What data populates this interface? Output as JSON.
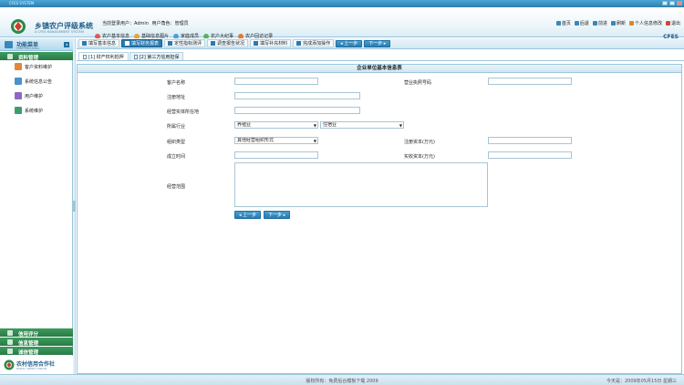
{
  "window": {
    "title": "CFES SYSTEM"
  },
  "header": {
    "app_title": "乡镇农户评级系统",
    "app_subtitle": "A CFES MANAGEMENT SYSTEM",
    "user_prefix": "当前登录用户：",
    "user_name": "Admin",
    "role_prefix": "用户角色：",
    "role_name": "管理员",
    "top_nav": [
      {
        "label": "农户基本信息",
        "color": "#e05a4b"
      },
      {
        "label": "基础信息图片",
        "color": "#e8a23a"
      },
      {
        "label": "家庭成员",
        "color": "#4aa0d8"
      },
      {
        "label": "农户大纪事",
        "color": "#58b15a"
      },
      {
        "label": "农户回访记录",
        "color": "#e07d2b"
      }
    ],
    "right_nav": [
      {
        "label": "首页",
        "color": "#3a87b9"
      },
      {
        "label": "后退",
        "color": "#3a87b9"
      },
      {
        "label": "前进",
        "color": "#3a87b9"
      },
      {
        "label": "刷新",
        "color": "#3a87b9"
      },
      {
        "label": "个人信息修改",
        "color": "#d28a2a"
      },
      {
        "label": "退出",
        "color": "#d04a3a"
      }
    ],
    "brand": "CFES"
  },
  "sidebar": {
    "title": "功能菜单",
    "subtitle": "FUNCTION MENU",
    "section_main": "资料管理",
    "items": [
      {
        "label": "客户资料维护",
        "color": "#e0873a"
      },
      {
        "label": "系统信息公告",
        "color": "#4a93c9"
      },
      {
        "label": "用户维护",
        "color": "#8b6bc1"
      },
      {
        "label": "系统维护",
        "color": "#3a9f6f"
      }
    ],
    "bottom_sections": [
      "信用评分",
      "信息管理",
      "诚信管理"
    ],
    "footer_title": "农村信用合作社",
    "footer_sub": "RURAL CREDIT UNION"
  },
  "steps": {
    "items": [
      {
        "label": "填写基本信息",
        "active": false
      },
      {
        "label": "填写财务报表",
        "active": true
      },
      {
        "label": "定性指标测评",
        "active": false
      },
      {
        "label": "调查报告状况",
        "active": false
      },
      {
        "label": "填写补充材料",
        "active": false
      },
      {
        "label": "完成添加操作",
        "active": false
      }
    ],
    "prev": "◂ 上一步",
    "next": "下一步 ▸"
  },
  "subtabs": [
    {
      "label": "[1] 财产权利抵押",
      "active": true
    },
    {
      "label": "[2] 第三方信用担保",
      "active": false
    }
  ],
  "form": {
    "heading": "企业单位基本信息表",
    "customer_name_label": "客户名称",
    "license_label": "营业执照号码",
    "reg_address_label": "注册地址",
    "biz_address_label": "经营实体所在地",
    "industry_label": "所属行业",
    "industry_value_1": "养殖业",
    "industry_value_2": "住宿业",
    "org_type_label": "组织类型",
    "org_type_value": "其他经营组织形式",
    "reg_capital_label": "注册资本(万元)",
    "found_time_label": "成立时间",
    "paid_capital_label": "实收资本(万元)",
    "scope_label": "经营范围",
    "prev_button": "◂ 上一步",
    "next_button": "下一步 ▸"
  },
  "status": {
    "copyright": "版权所有：免费后台模板下载 2009",
    "date": "今天是：2009年05月15日 星期三"
  }
}
